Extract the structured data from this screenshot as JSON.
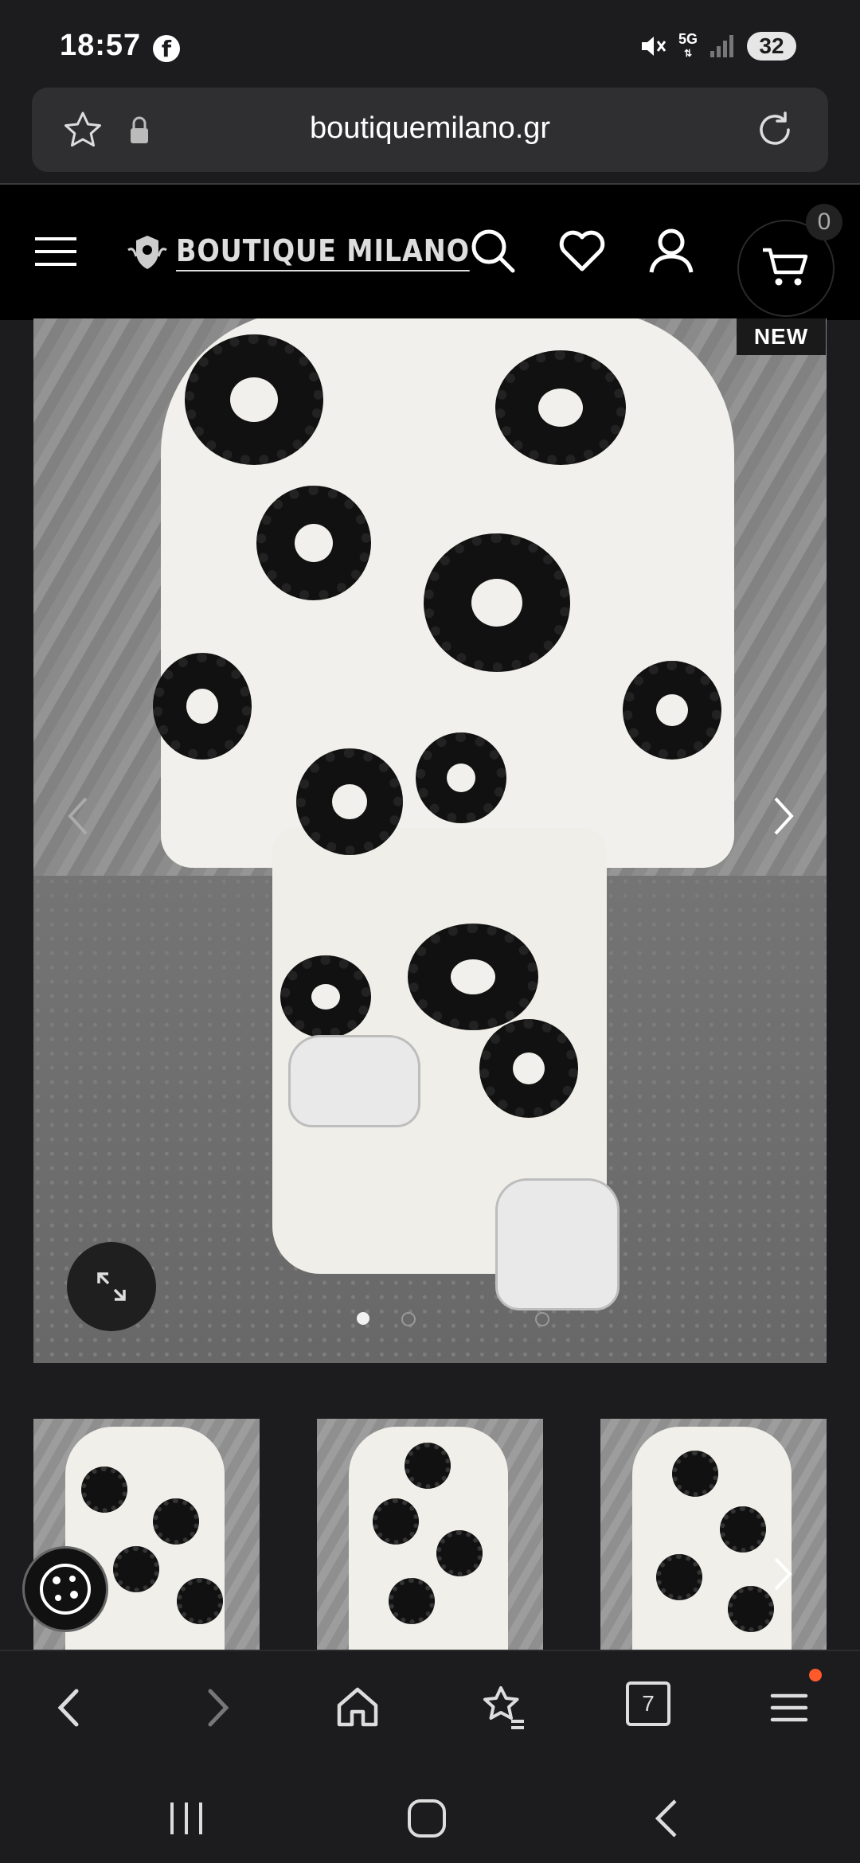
{
  "status_bar": {
    "time": "18:57",
    "facebook_glyph": "f",
    "network": "5G",
    "battery": "32"
  },
  "url_bar": {
    "url": "boutiquemilano.gr"
  },
  "site_header": {
    "logo_text": "BOUTIQUE MILANO",
    "cart_count": "0"
  },
  "product": {
    "badge": "NEW",
    "slide_count": 3,
    "active_slide": 1
  },
  "browser_toolbar": {
    "tabs_count": "7",
    "accent_dot_color": "#ff5a2b"
  },
  "icons": [
    "facebook-icon",
    "mute-icon",
    "signal-icon",
    "star-icon",
    "lock-icon",
    "reload-icon",
    "menu-icon",
    "search-icon",
    "heart-icon",
    "user-icon",
    "cart-icon",
    "chevron-left-icon",
    "chevron-right-icon",
    "expand-icon",
    "cookie-icon",
    "home-icon",
    "bookmarks-icon",
    "tabs-icon",
    "hamburger-icon"
  ]
}
